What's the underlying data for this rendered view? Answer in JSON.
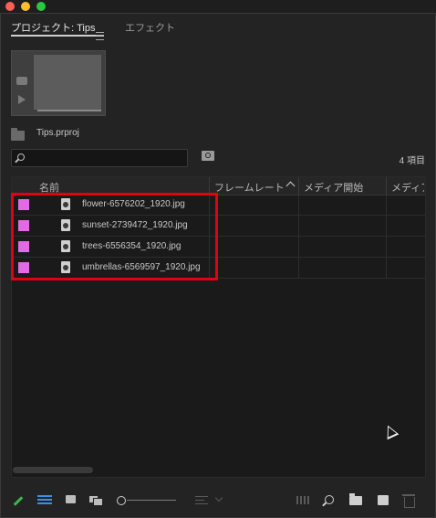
{
  "window": {
    "controls": [
      "close",
      "minimize",
      "maximize"
    ]
  },
  "tabs": {
    "project_label": "プロジェクト: Tips",
    "effects_label": "エフェクト"
  },
  "project": {
    "file_name": "Tips.prproj",
    "item_count": "4 項目",
    "search_value": ""
  },
  "table": {
    "columns": [
      "名前",
      "フレームレート",
      "メディア開始",
      "メディア"
    ],
    "rows": [
      {
        "name": "flower-6576202_1920.jpg",
        "label_color": "#e26ae3"
      },
      {
        "name": "sunset-2739472_1920.jpg",
        "label_color": "#e26ae3"
      },
      {
        "name": "trees-6556354_1920.jpg",
        "label_color": "#e26ae3"
      },
      {
        "name": "umbrellas-6569597_1920.jpg",
        "label_color": "#e26ae3"
      }
    ]
  },
  "colors": {
    "highlight_box": "#e3000f",
    "list_view_active": "#3b8fe6",
    "pencil_active": "#3bb84a"
  },
  "icons": [
    "camera-icon",
    "play-icon",
    "folder-icon",
    "search-icon",
    "bin-search-icon",
    "sort-asc-icon",
    "image-file-icon",
    "pencil-icon",
    "list-view-icon",
    "icon-view-icon",
    "freeform-view-icon",
    "zoom-slider",
    "sort-menu-icon",
    "automate-icon",
    "find-icon",
    "new-bin-icon",
    "new-item-icon",
    "trash-icon",
    "mouse-cursor-icon"
  ]
}
